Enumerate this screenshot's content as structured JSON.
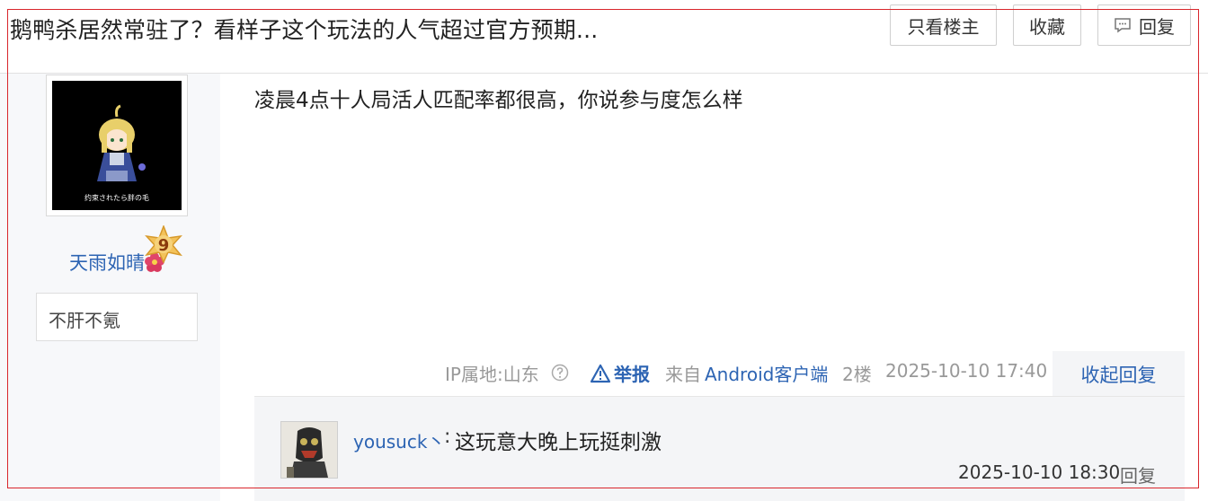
{
  "header": {
    "title": "鹅鸭杀居然常驻了？看样子这个玩法的人气超过官方预期...",
    "btn_only_op": "只看楼主",
    "btn_favorite": "收藏",
    "btn_reply": "回复"
  },
  "author": {
    "avatar_caption": "幼市されたら胖の毛",
    "name": "天雨如晴",
    "badge_text": "不肝不氪",
    "badge_level": "9"
  },
  "post": {
    "content": "凌晨4点十人局活人匹配率都很高，你说参与度怎么样",
    "ip_label": "IP属地:山东",
    "report_label": "举报",
    "from_label": "来自",
    "client_label": "Android客户端",
    "floor": "2楼",
    "date": "2025-10-10 17:40",
    "collapse_label": "收起回复"
  },
  "reply": {
    "user": "yousuck丶",
    "colon": ":",
    "text": "这玩意大晚上玩挺刺激",
    "date": "2025-10-10 18:30",
    "reply_label": "回复"
  },
  "colors": {
    "link_blue": "#2d64b3",
    "meta_gray": "#999999",
    "frame_red": "#d9262c",
    "badge_gold": "#f0b43c"
  }
}
